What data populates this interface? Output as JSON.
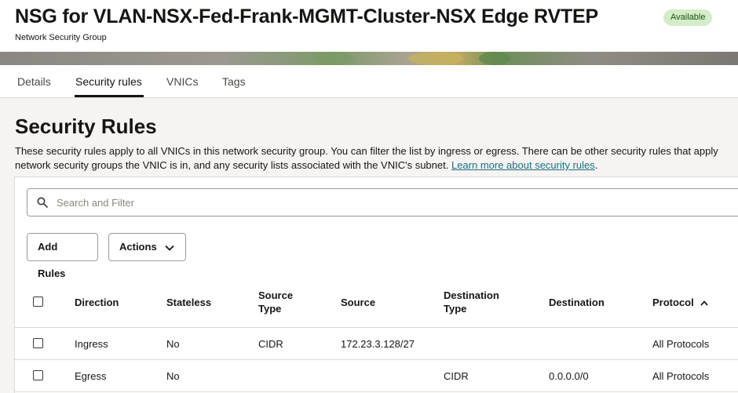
{
  "header": {
    "title": "NSG for VLAN-NSX-Fed-Frank-MGMT-Cluster-NSX Edge RVTEP",
    "status_badge": "Available",
    "subtitle": "Network Security Group"
  },
  "tabs": [
    {
      "label": "Details",
      "active": false
    },
    {
      "label": "Security rules",
      "active": true
    },
    {
      "label": "VNICs",
      "active": false
    },
    {
      "label": "Tags",
      "active": false
    }
  ],
  "section": {
    "title": "Security Rules",
    "description_line1": "These security rules apply to all VNICs in this network security group. You can filter the list by ingress or egress. There can be other security rules that apply",
    "description_line2": "network security groups the VNIC is in, and any security lists associated with the VNIC's subnet.",
    "learn_more_link": "Learn more about security rules",
    "learn_more_suffix": "."
  },
  "search": {
    "placeholder": "Search and Filter",
    "icon": "search-icon"
  },
  "toolbar": {
    "add_rules_label": "Add Rules",
    "actions_label": "Actions"
  },
  "table": {
    "columns": {
      "direction": "Direction",
      "stateless": "Stateless",
      "source_type_1": "Source",
      "source_type_2": "Type",
      "source": "Source",
      "destination_type_1": "Destination",
      "destination_type_2": "Type",
      "destination": "Destination",
      "protocol": "Protocol"
    },
    "sort": {
      "column": "Protocol",
      "direction": "ascending"
    },
    "rows": [
      {
        "direction": "Ingress",
        "stateless": "No",
        "source_type": "CIDR",
        "source": "172.23.3.128/27",
        "destination_type": "",
        "destination": "",
        "protocol": "All Protocols"
      },
      {
        "direction": "Egress",
        "stateless": "No",
        "source_type": "",
        "source": "",
        "destination_type": "CIDR",
        "destination": "0.0.0.0/0",
        "protocol": "All Protocols"
      }
    ]
  },
  "colors": {
    "link": "#1a6e83",
    "badge_bg": "#d4edc9",
    "badge_text": "#1d4d12",
    "background": "#f5f4f2"
  }
}
